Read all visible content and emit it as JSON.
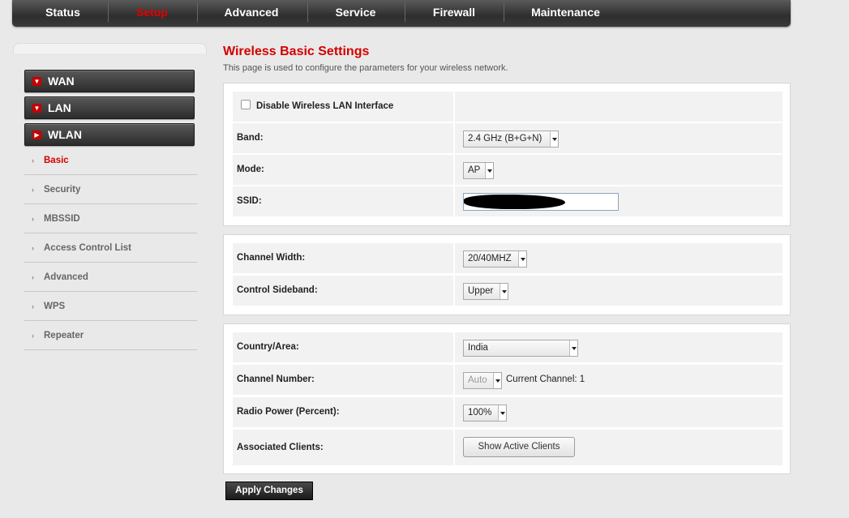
{
  "topnav": {
    "tabs": [
      "Status",
      "Setup",
      "Advanced",
      "Service",
      "Firewall",
      "Maintenance"
    ],
    "active": "Setup"
  },
  "sidebar": {
    "sections": [
      "WAN",
      "LAN",
      "WLAN"
    ],
    "items": [
      "Basic",
      "Security",
      "MBSSID",
      "Access Control List",
      "Advanced",
      "WPS",
      "Repeater"
    ],
    "active_item": "Basic"
  },
  "page": {
    "title": "Wireless Basic Settings",
    "description": "This page is used to configure the parameters for your wireless network."
  },
  "section1": {
    "disable_label": "Disable Wireless LAN Interface",
    "band_label": "Band:",
    "band_value": "2.4 GHz (B+G+N)",
    "mode_label": "Mode:",
    "mode_value": "AP",
    "ssid_label": "SSID:"
  },
  "section2": {
    "width_label": "Channel Width:",
    "width_value": "20/40MHZ",
    "sideband_label": "Control Sideband:",
    "sideband_value": "Upper"
  },
  "section3": {
    "country_label": "Country/Area:",
    "country_value": "India",
    "channel_label": "Channel Number:",
    "channel_value": "Auto",
    "current_channel": "Current Channel: 1",
    "power_label": "Radio Power (Percent):",
    "power_value": "100%",
    "clients_label": "Associated Clients:",
    "clients_button": "Show Active Clients"
  },
  "apply_label": "Apply Changes",
  "colors": {
    "accent": "#d40000",
    "nav_bg": "#333333"
  }
}
